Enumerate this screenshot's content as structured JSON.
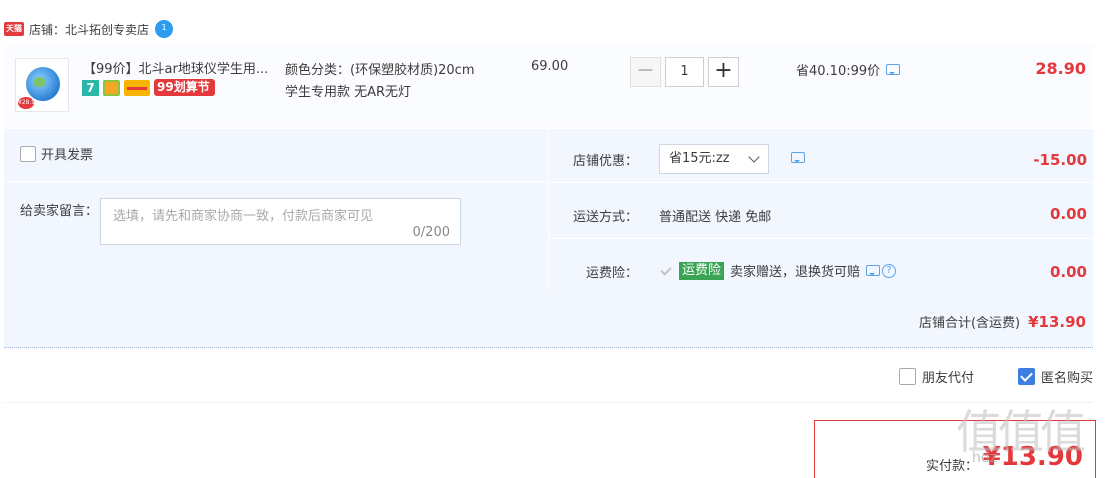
{
  "shop": {
    "logo_text": "天猫",
    "prefix": "店铺：",
    "name": "北斗拓创专卖店",
    "ww_badge": "1"
  },
  "item": {
    "thumb_price": "¥28.9",
    "title": "【99价】北斗ar地球仪学生用...",
    "badges": {
      "seven_day": "7",
      "huasuan": "划算节",
      "huasuan_prefix": "99"
    },
    "sku_line1": "颜色分类：(环保塑胶材质)20cm",
    "sku_line2": "学生专用款 无AR无灯",
    "unit_price": "69.00",
    "quantity": "1",
    "discount_text": "省40.10:99价",
    "total": "28.90"
  },
  "detail": {
    "invoice_label": "开具发票",
    "message_label": "给卖家留言：",
    "message_placeholder": "选填，请先和商家协商一致，付款后商家可见",
    "message_count": "0/200",
    "coupon_label": "店铺优惠：",
    "coupon_selected": "省15元:zz",
    "coupon_value": "-15.00",
    "shipping_label": "运送方式：",
    "shipping_text": "普通配送 快递 免邮",
    "shipping_value": "0.00",
    "insurance_label": "运费险：",
    "insurance_badge": "运费险",
    "insurance_text": "卖家赠送，退换货可赔",
    "insurance_value": "0.00",
    "shop_total_label": "店铺合计(含运费)",
    "shop_total_value": "¥13.90"
  },
  "options": {
    "friend_pay": "朋友代付",
    "anonymous": "匿名购买",
    "anonymous_checked": true
  },
  "payment": {
    "label": "实付款：",
    "value": "¥13.90"
  },
  "watermark": {
    "text": "值值值",
    "site": "hdz"
  },
  "colors": {
    "accent_red": "#e4393c",
    "panel_blue": "#f2f7ff",
    "check_blue": "#3d7fe0",
    "insurance_green": "#3aa455"
  }
}
